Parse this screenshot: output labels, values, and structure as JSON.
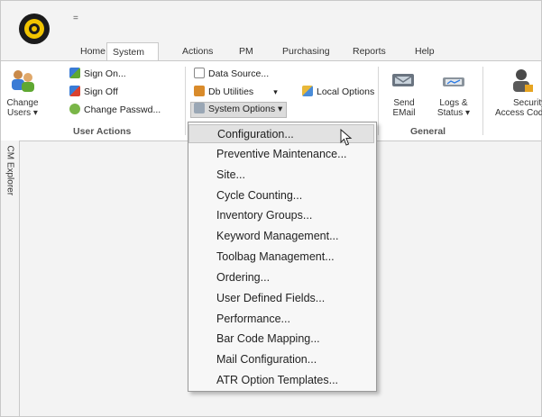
{
  "tabs": [
    "Home",
    "System",
    "Actions",
    "PM",
    "Purchasing",
    "Reports",
    "Help"
  ],
  "active_tab": "System",
  "ribbon": {
    "change_users": "Change\nUsers ▾",
    "change_users_l1": "Change",
    "change_users_l2": "Users ▾",
    "sign_on": "Sign On...",
    "sign_off": "Sign Off",
    "change_passwd": "Change Passwd...",
    "user_actions_label": "User Actions",
    "data_source": "Data Source...",
    "db_utilities": "Db Utilities",
    "local_options": "Local Options",
    "system_options": "System Options ▾",
    "send_email": "Send EMail",
    "logs_status_l1": "Logs &",
    "logs_status_l2": "Status ▾",
    "general_label": "General",
    "security_l1": "Security",
    "security_l2": "Access Code"
  },
  "explorer_label": "CM Explorer",
  "menu_items": [
    "Configuration...",
    "Preventive Maintenance...",
    "Site...",
    "Cycle Counting...",
    "Inventory Groups...",
    "Keyword Management...",
    "Toolbag Management...",
    "Ordering...",
    "User Defined Fields...",
    "Performance...",
    "Bar Code Mapping...",
    "Mail Configuration...",
    "ATR Option Templates..."
  ],
  "highlighted_menu_item": "Configuration...",
  "qat_symbol": "="
}
